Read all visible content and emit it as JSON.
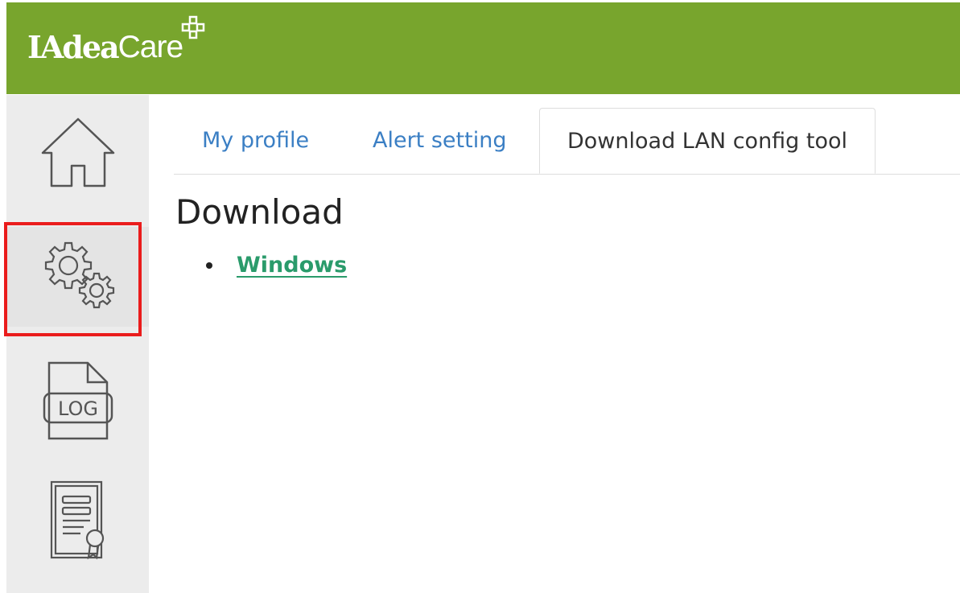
{
  "header": {
    "logo_main": "IAdea",
    "logo_sub": "Care",
    "background_color": "#78a52d"
  },
  "sidebar": {
    "items": [
      {
        "icon": "home-icon",
        "active": false
      },
      {
        "icon": "gear-icon",
        "active": true,
        "highlighted": true
      },
      {
        "icon": "log-file-icon",
        "active": false
      },
      {
        "icon": "license-certificate-icon",
        "active": false
      }
    ],
    "highlight_color": "#ea1c1c"
  },
  "tabs": [
    {
      "label": "My profile",
      "active": false
    },
    {
      "label": "Alert setting",
      "active": false
    },
    {
      "label": "Download LAN config tool",
      "active": true
    }
  ],
  "content": {
    "title": "Download",
    "links": [
      {
        "label": "Windows"
      }
    ]
  },
  "colors": {
    "tab_link": "#3b7fc4",
    "download_link": "#2a9b6b"
  }
}
